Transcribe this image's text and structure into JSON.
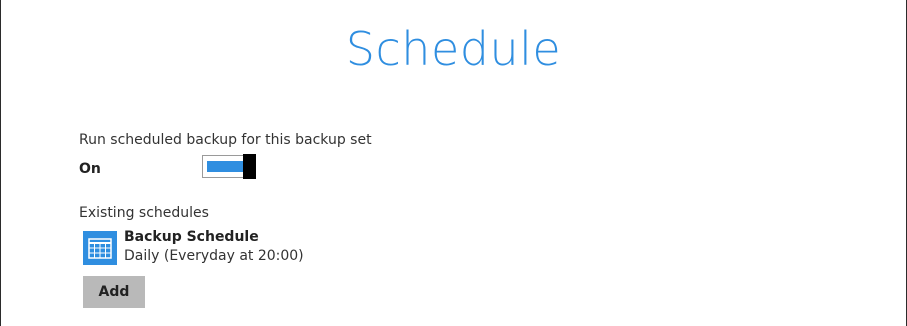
{
  "page": {
    "title": "Schedule"
  },
  "run_scheduled": {
    "label": "Run scheduled backup for this backup set",
    "state_text": "On",
    "enabled": true
  },
  "existing": {
    "label": "Existing schedules",
    "schedules": [
      {
        "name": "Backup Schedule",
        "detail": "Daily (Everyday at 20:00)",
        "icon": "calendar-icon"
      }
    ]
  },
  "actions": {
    "add_label": "Add"
  },
  "colors": {
    "accent": "#2f8ee0",
    "button_bg": "#b9b9b9"
  }
}
